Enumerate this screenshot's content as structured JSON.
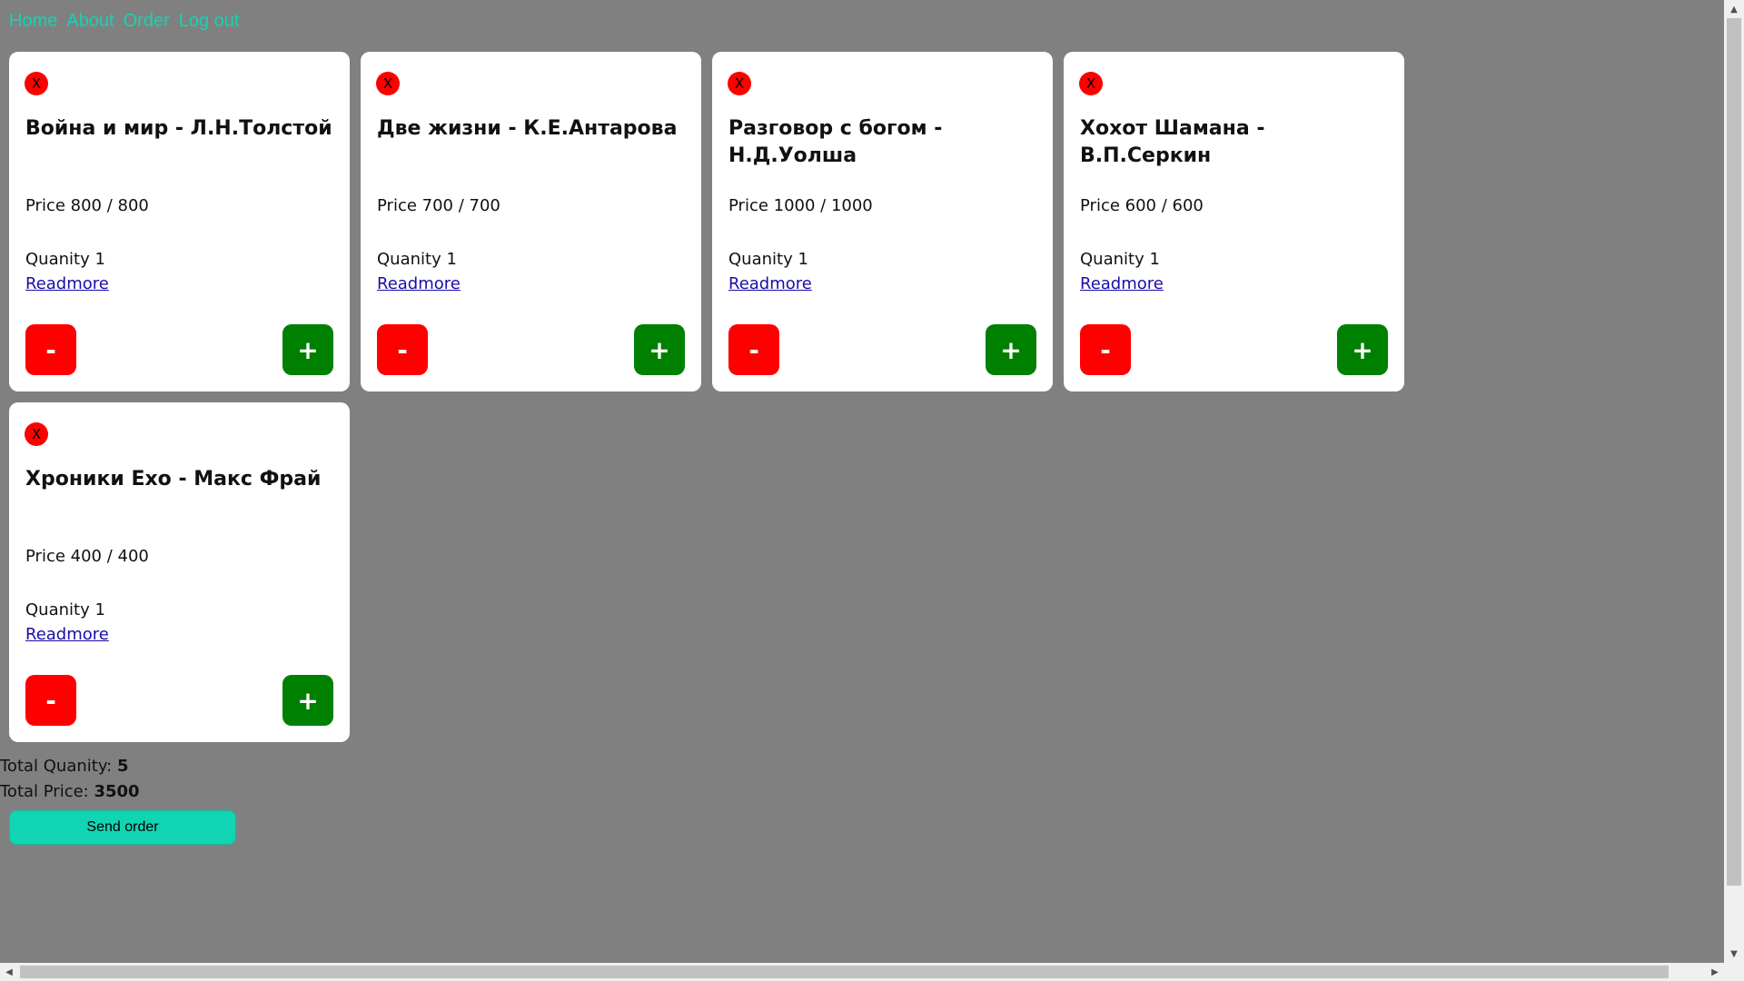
{
  "nav": {
    "home": "Home",
    "about": "About",
    "order": "Order",
    "logout": "Log out",
    "color": "#11d4b3"
  },
  "cards": [
    {
      "remove_label": "X",
      "title": "Война и мир - Л.Н.Толстой",
      "price": "Price 800 / 800",
      "quantity": "Quanity 1",
      "readmore": "Readmore",
      "minus_label": "-",
      "plus_label": "+"
    },
    {
      "remove_label": "X",
      "title": "Две жизни - К.Е.Антарова",
      "price": "Price 700 / 700",
      "quantity": "Quanity 1",
      "readmore": "Readmore",
      "minus_label": "-",
      "plus_label": "+"
    },
    {
      "remove_label": "X",
      "title": "Разговор с богом - Н.Д.Уолша",
      "price": "Price 1000 / 1000",
      "quantity": "Quanity 1",
      "readmore": "Readmore",
      "minus_label": "-",
      "plus_label": "+"
    },
    {
      "remove_label": "X",
      "title": "Хохот Шамана - В.П.Серкин",
      "price": "Price 600 / 600",
      "quantity": "Quanity 1",
      "readmore": "Readmore",
      "minus_label": "-",
      "plus_label": "+"
    },
    {
      "remove_label": "X",
      "title": "Хроники Ехо - Макс Фрай",
      "price": "Price 400 / 400",
      "quantity": "Quanity 1",
      "readmore": "Readmore",
      "minus_label": "-",
      "plus_label": "+"
    }
  ],
  "totals": {
    "quantity_label": "Total Quanity: ",
    "quantity_value": "5",
    "price_label": "Total Price: ",
    "price_value": "3500"
  },
  "send_button": "Send order",
  "colors": {
    "background": "#808080",
    "minus": "#ff0000",
    "plus": "#008000",
    "remove": "#ff0000",
    "send": "#11d4b3",
    "link": "#1a0dab"
  }
}
